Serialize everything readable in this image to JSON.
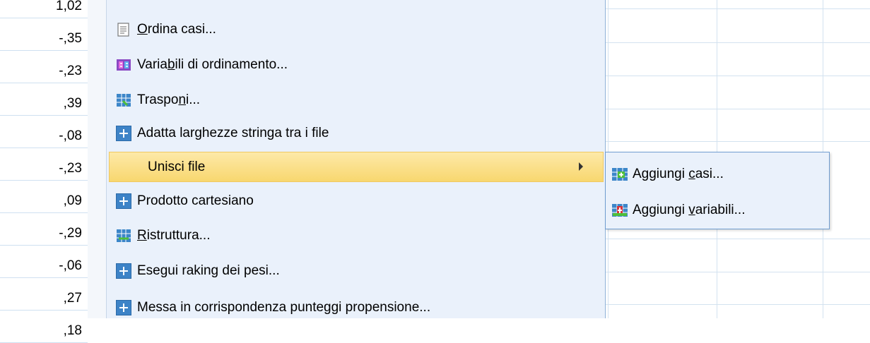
{
  "numbers": [
    "1,02",
    "-,35",
    "-,23",
    ",39",
    "-,08",
    "-,23",
    ",09",
    "-,29",
    "-,06",
    ",27",
    ",18"
  ],
  "menu": {
    "items": [
      {
        "pre": "",
        "u": "O",
        "post": "rdina casi...",
        "icon": "sort-cases-icon"
      },
      {
        "pre": "Varia",
        "u": "b",
        "post": "ili di ordinamento...",
        "icon": "sort-variables-icon"
      },
      {
        "pre": "Traspo",
        "u": "n",
        "post": "i...",
        "icon": "transpose-icon"
      },
      {
        "pre": "Adatta larghezze stringa tra i file",
        "u": "",
        "post": "",
        "icon": "plus-icon"
      },
      {
        "pre": "Unisci file",
        "u": "",
        "post": "",
        "icon": "none"
      },
      {
        "pre": "Prodotto cartesiano",
        "u": "",
        "post": "",
        "icon": "plus-icon"
      },
      {
        "pre": "",
        "u": "R",
        "post": "istruttura...",
        "icon": "restructure-icon"
      },
      {
        "pre": "Esegui raking dei pesi...",
        "u": "",
        "post": "",
        "icon": "plus-icon"
      },
      {
        "pre": "Messa in corrispondenza punteggi propensione...",
        "u": "",
        "post": "",
        "icon": "plus-icon"
      }
    ]
  },
  "submenu": {
    "items": [
      {
        "pre": "Aggiungi ",
        "u": "c",
        "post": "asi...",
        "icon": "add-cases-icon"
      },
      {
        "pre": "Aggiungi ",
        "u": "v",
        "post": "ariabili...",
        "icon": "add-variables-icon"
      }
    ]
  },
  "colors": {
    "highlight": "#f8d76f",
    "menu_bg": "#eaf1fb",
    "plus_icon": "#3d83c7"
  }
}
